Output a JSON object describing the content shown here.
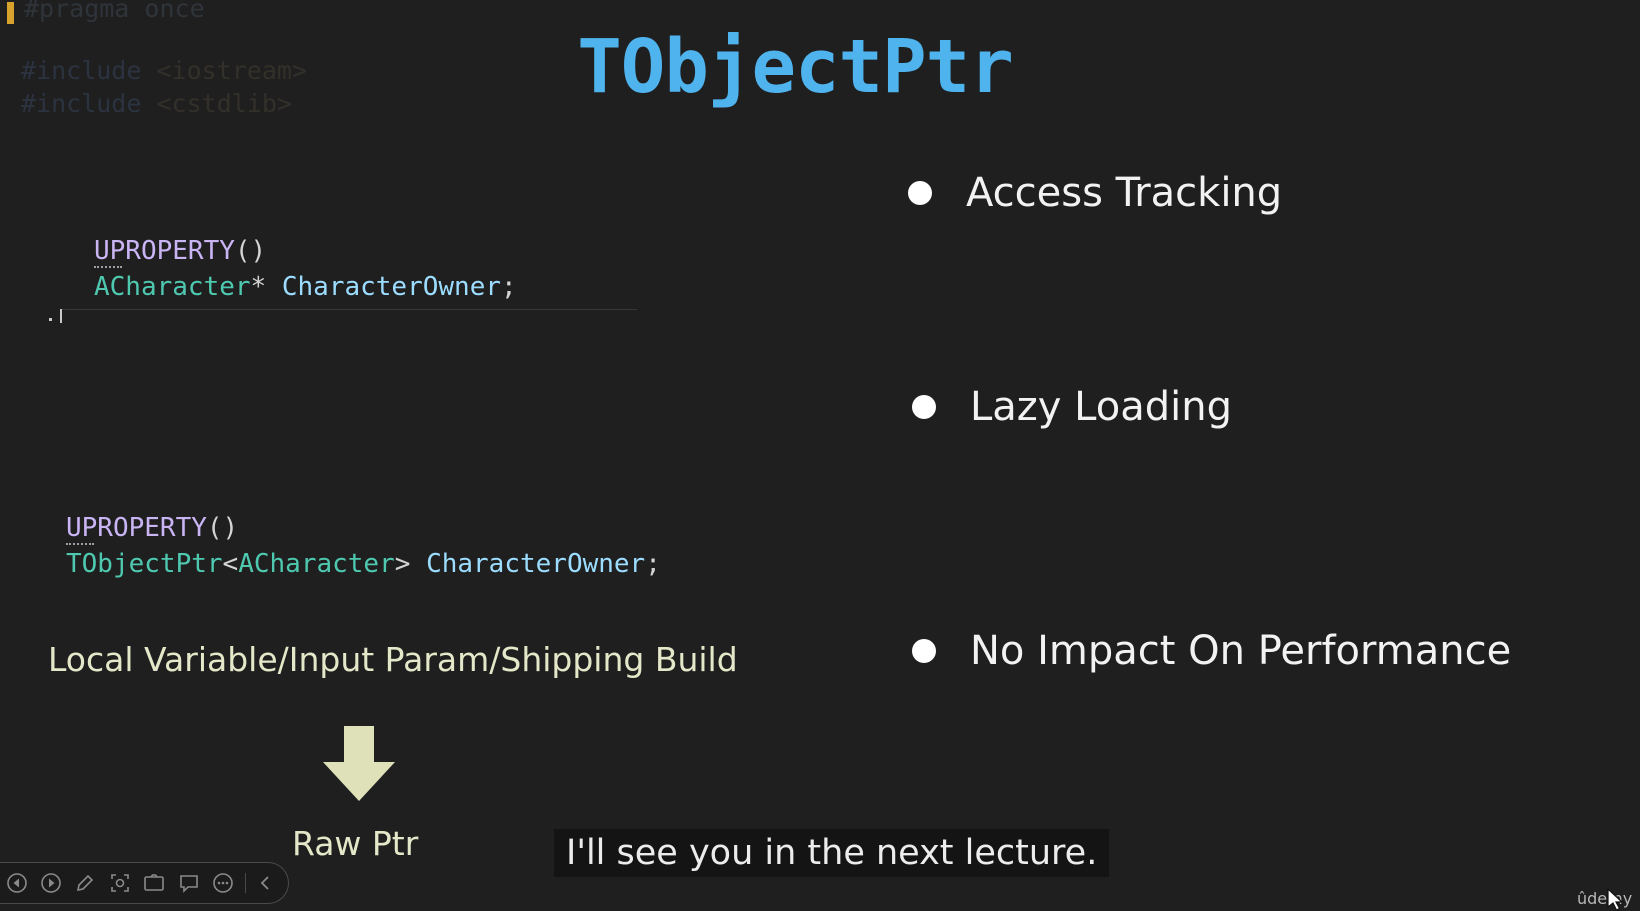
{
  "background_code": {
    "line1": "#pragma once",
    "line2_directive": "#include",
    "line2_header": "<iostream>",
    "line3_directive": "#include",
    "line3_header": "<cstdlib>"
  },
  "title": "TObjectPtr",
  "code_raw": {
    "macro": "UPROPERTY",
    "macro_parens": "()",
    "type": "ACharacter",
    "pointer": "*",
    "name": "CharacterOwner",
    "semicolon": ";"
  },
  "code_tobjectptr": {
    "macro": "UPROPERTY",
    "macro_parens": "()",
    "wrapper": "TObjectPtr",
    "open_angle": "<",
    "type": "ACharacter",
    "close_angle": ">",
    "name": "CharacterOwner",
    "semicolon": ";"
  },
  "bullets": [
    {
      "label": "Access Tracking"
    },
    {
      "label": "Lazy Loading"
    },
    {
      "label": "No Impact On Performance"
    }
  ],
  "note": "Local Variable/Input Param/Shipping Build",
  "result": "Raw Ptr",
  "subtitle": "I'll see you in the next lecture.",
  "watermark": "ûdemy",
  "player_controls": [
    {
      "icon": "previous-icon"
    },
    {
      "icon": "next-icon"
    },
    {
      "icon": "pencil-icon"
    },
    {
      "icon": "zoom-icon"
    },
    {
      "icon": "camera-icon"
    },
    {
      "icon": "subtitles-icon"
    },
    {
      "icon": "more-icon"
    },
    {
      "icon": "collapse-icon"
    }
  ],
  "colors": {
    "title": "#4fb3ee",
    "macro": "#c9b4f4",
    "type": "#4ec9b0",
    "identifier": "#9cdcfe",
    "note": "#e4e7c8",
    "arrow": "#dfe2b8",
    "background": "#1f1f1f"
  }
}
